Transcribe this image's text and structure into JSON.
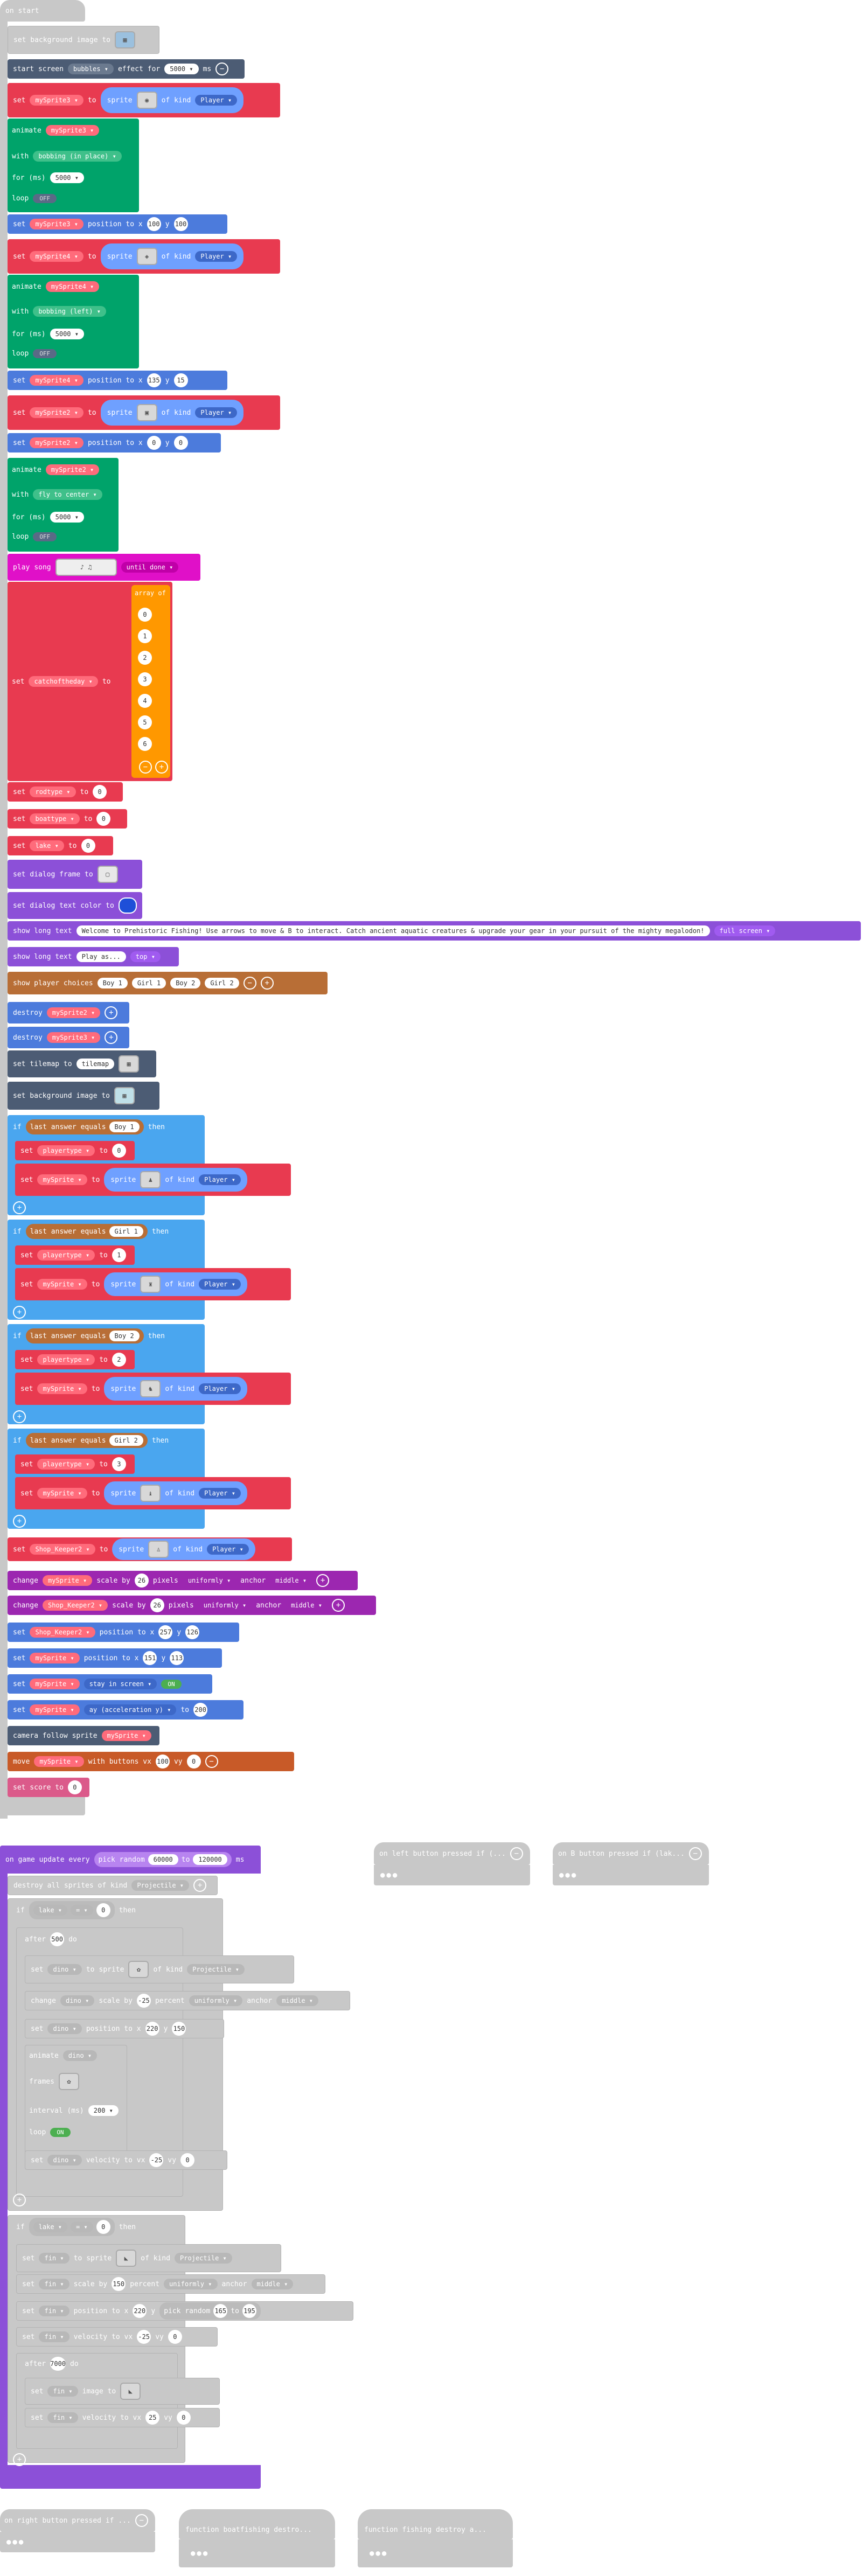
{
  "on_start": {
    "hat": "on start",
    "set_bg_image": "set background image to",
    "start_screen": "start screen",
    "effect_name": "bubbles",
    "effect_word": "effect for",
    "effect_ms": "5000",
    "ms": "ms",
    "set": "set",
    "to": "to",
    "sprite": "sprite",
    "of_kind": "of kind",
    "kind_player": "Player",
    "var_mySprite3": "mySprite3",
    "var_mySprite4": "mySprite4",
    "var_mySprite2": "mySprite2",
    "animate": "animate",
    "with": "with",
    "bob_in_place": "bobbing (in place)",
    "bob_left": "bobbing (left)",
    "fly_center": "fly to center",
    "for_ms": "for (ms)",
    "anim_ms": "5000",
    "loop": "loop",
    "off": "OFF",
    "position_to_x": "position to x",
    "y": "y",
    "s3_x": "100",
    "s3_y": "100",
    "s4_x": "135",
    "s4_y": "15",
    "s2_x": "0",
    "s2_y": "0",
    "play": "play",
    "song": "song",
    "until_done": "until done",
    "var_catch": "catchoftheday",
    "array_of": "array of",
    "array_values": [
      "0",
      "1",
      "2",
      "3",
      "4",
      "5",
      "6"
    ],
    "var_rodtype": "rodtype",
    "rodtype_val": "0",
    "var_boattype": "boattype",
    "boattype_val": "0",
    "var_lake": "lake",
    "lake_val": "0",
    "dialog_frame": "set dialog frame to",
    "dialog_text_color": "set dialog text color to",
    "dialog_color": "#1e4fd8",
    "show_long_text": "show long text",
    "long_text_1": "Welcome to Prehistoric Fishing! Use arrows to move & B to interact. Catch ancient aquatic creatures & upgrade your gear in your pursuit of the mighty megalodon!",
    "full_screen": "full screen",
    "long_text_2": "Play as...",
    "top": "top",
    "show_player_choices": "show player choices",
    "choices": [
      "Boy 1",
      "Girl 1",
      "Boy 2",
      "Girl 2"
    ],
    "destroy": "destroy",
    "set_tilemap": "set tilemap to",
    "tilemap": "tilemap",
    "if": "if",
    "then": "then",
    "last_answer_equals": "last answer equals",
    "var_playertype": "playertype",
    "var_mySprite": "mySprite",
    "branches": [
      {
        "answer": "Boy 1",
        "val": "0"
      },
      {
        "answer": "Girl 1",
        "val": "1"
      },
      {
        "answer": "Boy 2",
        "val": "2"
      },
      {
        "answer": "Girl 2",
        "val": "3"
      }
    ],
    "var_shop": "Shop_Keeper2",
    "change": "change",
    "scale_by": "scale by",
    "scale_val": "26",
    "pixels": "pixels",
    "uniformly": "uniformly",
    "anchor": "anchor",
    "middle": "middle",
    "shop_x": "257",
    "shop_y": "126",
    "my_x": "151",
    "my_y": "113",
    "stay_in_screen": "stay in screen",
    "on": "ON",
    "ay_accel": "ay (acceleration y)",
    "ay_val": "200",
    "camera_follow": "camera follow sprite",
    "move": "move",
    "with_buttons": "with buttons vx",
    "vx": "100",
    "vy_label": "vy",
    "vy": "0",
    "set_score": "set score to",
    "score": "0"
  },
  "game_update": {
    "hat": "on game update every",
    "pick_random": "pick random",
    "min": "60000",
    "max": "120000",
    "ms": "ms",
    "destroy_all": "destroy all sprites of kind",
    "kind_proj": "Projectile",
    "if": "if",
    "then": "then",
    "lake": "lake",
    "eq": "=",
    "zero": "0",
    "after": "after",
    "after_ms": "500",
    "do": "do",
    "dino": "dino",
    "set": "set",
    "to": "to",
    "sprite": "sprite",
    "of_kind": "of kind",
    "change": "change",
    "scale_by": "scale by",
    "neg25": "-25",
    "percent": "percent",
    "uniformly": "uniformly",
    "anchor": "anchor",
    "middle": "middle",
    "position_to_x": "position to x",
    "y": "y",
    "dino_x": "220",
    "dino_y": "150",
    "animate": "animate",
    "frames": "frames",
    "interval": "interval (ms)",
    "interval_val": "200",
    "loop": "loop",
    "on": "ON",
    "velocity": "velocity to vx",
    "vy": "vy",
    "fin": "fin",
    "fin_scale": "150",
    "fin_x": "220",
    "fin_pick": "pick random",
    "fin_min": "165",
    "fin_max": "195",
    "after2_ms": "7000",
    "image_to": "image to",
    "vx25": "25"
  },
  "floating": {
    "left_btn": "on left button pressed if (...",
    "b_btn": "on B button pressed if (lak...",
    "right_btn": "on right button pressed if ...",
    "func_boat": "function boatfishing  destro...",
    "func_fish": "function fishing  destroy a..."
  }
}
